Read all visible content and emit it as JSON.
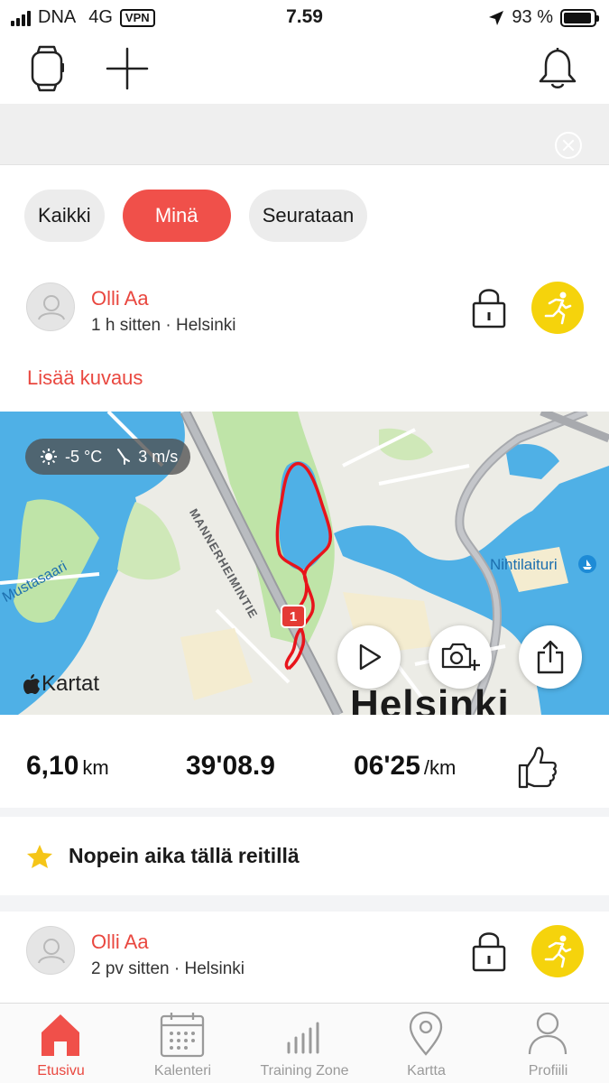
{
  "status_bar": {
    "carrier": "DNA",
    "network": "4G",
    "vpn": "VPN",
    "time": "7.59",
    "battery": "93 %",
    "battery_level": 0.93
  },
  "feed_filters": {
    "items": [
      {
        "label": "Kaikki",
        "active": false
      },
      {
        "label": "Minä",
        "active": true
      },
      {
        "label": "Seurataan",
        "active": false
      }
    ]
  },
  "activity_1": {
    "user": "Olli Aa",
    "meta": "1 h sitten · Helsinki",
    "add_description": "Lisää kuvaus",
    "map": {
      "weather_temp": "-5 °C",
      "weather_wind": "3 m/s",
      "street_label": "MANNERHEIMINTIE",
      "place_label_1": "Mustasaari",
      "place_label_2": "Nihtilaituri",
      "city_label": "Helsinki",
      "provider": "Kartat",
      "lap_marker": "1"
    },
    "distance_value": "6,10",
    "distance_unit": "km",
    "duration": "39'08.9",
    "pace_value": "06'25",
    "pace_unit": "/km",
    "record_text": "Nopein aika tällä reitillä"
  },
  "activity_2": {
    "user": "Olli Aa",
    "meta": "2 pv sitten · Helsinki"
  },
  "tabbar": {
    "items": [
      {
        "label": "Etusivu",
        "active": true
      },
      {
        "label": "Kalenteri",
        "active": false
      },
      {
        "label": "Training Zone",
        "active": false
      },
      {
        "label": "Kartta",
        "active": false
      },
      {
        "label": "Profiili",
        "active": false
      }
    ]
  },
  "colors": {
    "accent": "#e9473f",
    "sport_badge": "#f5d30c",
    "route": "#e8141b",
    "water": "#4fb0e6",
    "park": "#bfe4a8"
  }
}
